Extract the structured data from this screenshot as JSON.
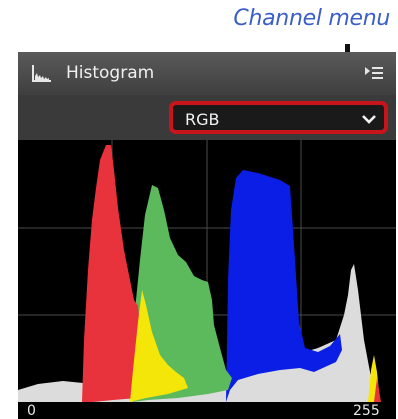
{
  "callout": {
    "label": "Channel menu"
  },
  "panel": {
    "title": "Histogram",
    "icon": "histogram-icon",
    "menu_icon": "panel-menu-icon",
    "channel_select": {
      "value": "RGB",
      "icon": "chevron-down-icon"
    },
    "axis": {
      "min_label": "0",
      "max_label": "255"
    },
    "colors": {
      "background": "#000000",
      "red": "#e8323c",
      "green": "#5cb95c",
      "blue": "#0a1ee6",
      "yellow": "#f5e60a",
      "gray": "#dcdcdc",
      "cyan": "#28b4dc",
      "grid": "#4a4a4a",
      "highlight": "#c8151b"
    }
  }
}
